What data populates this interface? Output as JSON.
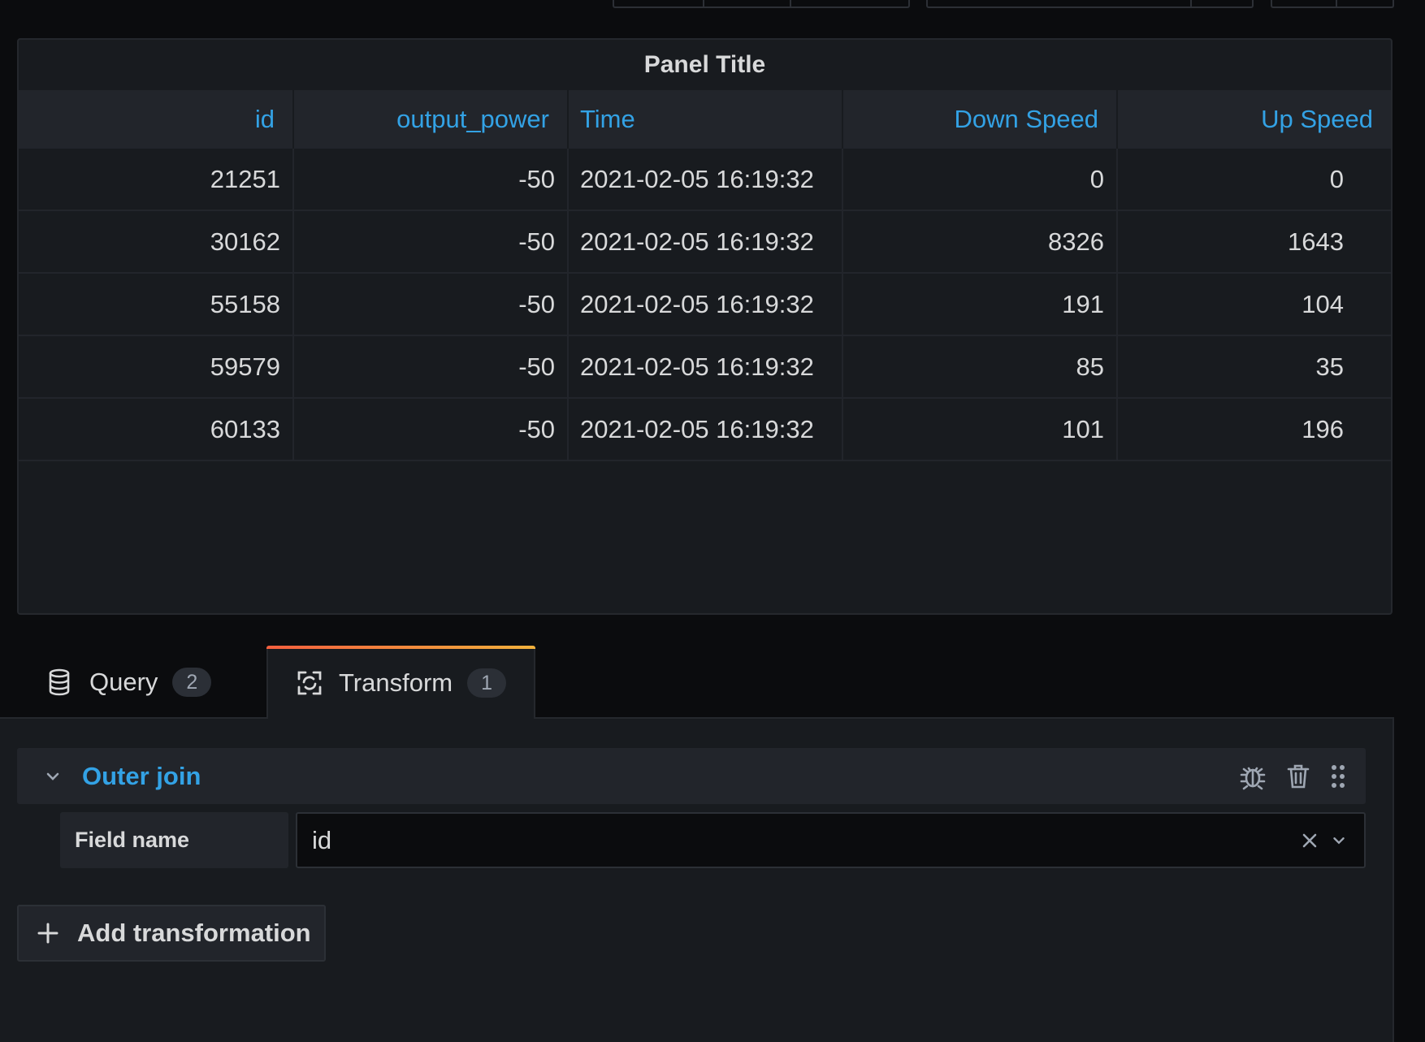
{
  "panel": {
    "title": "Panel Title",
    "columns": [
      "id",
      "output_power",
      "Time",
      "Down Speed",
      "Up Speed"
    ],
    "rows": [
      [
        "21251",
        "-50",
        "2021-02-05 16:19:32",
        "0",
        "0"
      ],
      [
        "30162",
        "-50",
        "2021-02-05 16:19:32",
        "8326",
        "1643"
      ],
      [
        "55158",
        "-50",
        "2021-02-05 16:19:32",
        "191",
        "104"
      ],
      [
        "59579",
        "-50",
        "2021-02-05 16:19:32",
        "85",
        "35"
      ],
      [
        "60133",
        "-50",
        "2021-02-05 16:19:32",
        "101",
        "196"
      ]
    ]
  },
  "tabs": {
    "query": {
      "label": "Query",
      "count": "2",
      "icon": "database-icon"
    },
    "transform": {
      "label": "Transform",
      "count": "1",
      "icon": "transform-icon"
    }
  },
  "transformation": {
    "title": "Outer join",
    "field_label": "Field name",
    "field_value": "id",
    "actions": [
      "debug-icon",
      "trash-icon",
      "drag-handle-icon"
    ]
  },
  "add_button": {
    "label": "Add transformation",
    "icon": "plus-icon"
  },
  "colors": {
    "accent": "#33a2e5",
    "panel_bg": "#181b1f",
    "page_bg": "#0b0c0e",
    "tab_gradient": [
      "#f55f3e",
      "#f1b13c"
    ]
  }
}
